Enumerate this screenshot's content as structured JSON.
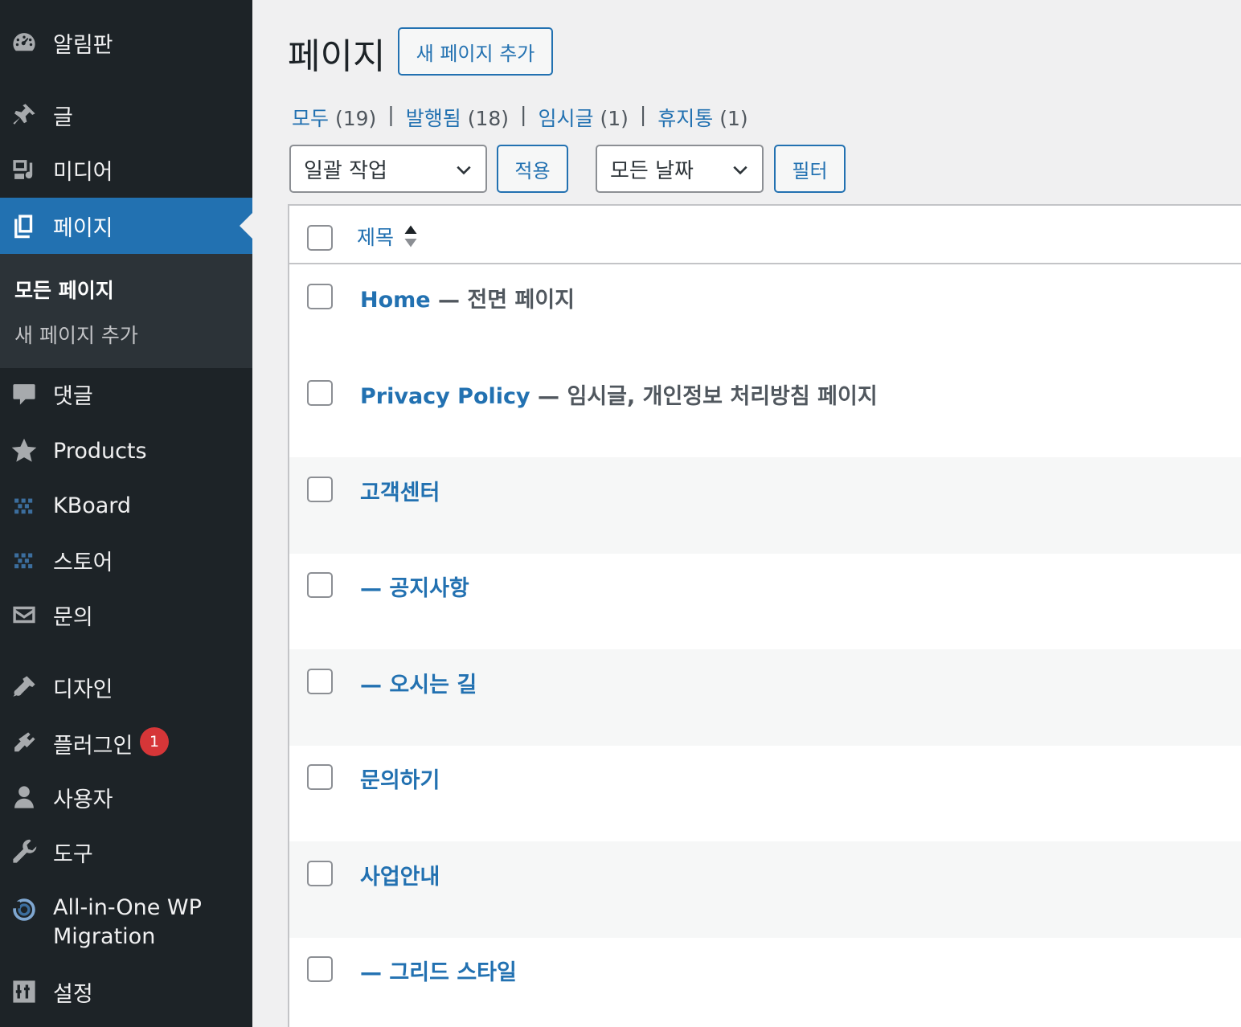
{
  "sidebar": {
    "items": [
      {
        "label": "알림판",
        "icon": "dashboard-icon"
      },
      {
        "label": "글",
        "icon": "pin-icon"
      },
      {
        "label": "미디어",
        "icon": "media-icon"
      },
      {
        "label": "페이지",
        "icon": "pages-icon",
        "active": true
      },
      {
        "label": "댓글",
        "icon": "comment-icon"
      },
      {
        "label": "Products",
        "icon": "star-icon"
      },
      {
        "label": "KBoard",
        "icon": "kboard-icon"
      },
      {
        "label": "스토어",
        "icon": "store-icon"
      },
      {
        "label": "문의",
        "icon": "mail-icon"
      },
      {
        "label": "디자인",
        "icon": "brush-icon"
      },
      {
        "label": "플러그인",
        "icon": "plugin-icon",
        "badge": "1"
      },
      {
        "label": "사용자",
        "icon": "user-icon"
      },
      {
        "label": "도구",
        "icon": "wrench-icon"
      },
      {
        "label": "All-in-One WP Migration",
        "icon": "migration-icon"
      },
      {
        "label": "설정",
        "icon": "settings-icon"
      }
    ],
    "submenu": [
      {
        "label": "모든 페이지",
        "current": true
      },
      {
        "label": "새 페이지 추가"
      }
    ]
  },
  "header": {
    "title": "페이지",
    "add_new_label": "새 페이지 추가"
  },
  "filters": {
    "all": {
      "label": "모두",
      "count": "(19)"
    },
    "published": {
      "label": "발행됨",
      "count": "(18)"
    },
    "draft": {
      "label": "임시글",
      "count": "(1)"
    },
    "trash": {
      "label": "휴지통",
      "count": "(1)"
    },
    "separator": "|"
  },
  "toolbar": {
    "bulk_action": "일괄 작업",
    "apply_label": "적용",
    "date_filter": "모든 날짜",
    "filter_label": "필터"
  },
  "table": {
    "column_title": "제목",
    "rows": [
      {
        "title": "Home",
        "state": " — 전면 페이지"
      },
      {
        "title": "Privacy Policy",
        "state": " — 임시글, 개인정보 처리방침 페이지"
      },
      {
        "title": "고객센터",
        "state": ""
      },
      {
        "title": "— 공지사항",
        "state": ""
      },
      {
        "title": "— 오시는 길",
        "state": ""
      },
      {
        "title": "문의하기",
        "state": ""
      },
      {
        "title": "사업안내",
        "state": ""
      },
      {
        "title": "— 그리드 스타일",
        "state": ""
      }
    ]
  },
  "colors": {
    "sidebar_bg": "#1d2327",
    "accent": "#2271b1",
    "badge": "#d63638"
  }
}
